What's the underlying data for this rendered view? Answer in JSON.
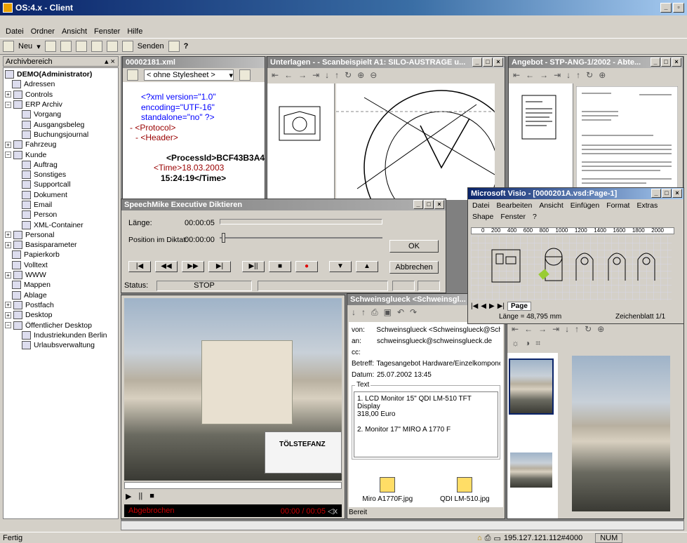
{
  "app": {
    "title": "OS:4.x - Client",
    "status": "Fertig",
    "ip": "195.127.121.112#4000",
    "num": "NUM"
  },
  "menu": [
    "Datei",
    "Ordner",
    "Ansicht",
    "Fenster",
    "Hilfe"
  ],
  "toolbar": {
    "new_label": "Neu",
    "send_label": "Senden"
  },
  "sidebar": {
    "title": "Archivbereich",
    "items": [
      {
        "label": "DEMO(Administrator)",
        "indent": 0,
        "bold": true
      },
      {
        "label": "Adressen",
        "indent": 1
      },
      {
        "label": "Controls",
        "indent": 0,
        "pm": "+"
      },
      {
        "label": "ERP Archiv",
        "indent": 0,
        "pm": "−"
      },
      {
        "label": "Vorgang",
        "indent": 2
      },
      {
        "label": "Ausgangsbeleg",
        "indent": 2
      },
      {
        "label": "Buchungsjournal",
        "indent": 2
      },
      {
        "label": "Fahrzeug",
        "indent": 0,
        "pm": "+"
      },
      {
        "label": "Kunde",
        "indent": 0,
        "pm": "−"
      },
      {
        "label": "Auftrag",
        "indent": 2
      },
      {
        "label": "Sonstiges",
        "indent": 2
      },
      {
        "label": "Supportcall",
        "indent": 2
      },
      {
        "label": "Dokument",
        "indent": 2
      },
      {
        "label": "Email",
        "indent": 2
      },
      {
        "label": "Person",
        "indent": 2
      },
      {
        "label": "XML-Container",
        "indent": 2
      },
      {
        "label": "Personal",
        "indent": 0,
        "pm": "+"
      },
      {
        "label": "Basisparameter",
        "indent": 0,
        "pm": "+"
      },
      {
        "label": "Papierkorb",
        "indent": 1
      },
      {
        "label": "Volltext",
        "indent": 1
      },
      {
        "label": "WWW",
        "indent": 0,
        "pm": "+"
      },
      {
        "label": "Mappen",
        "indent": 1
      },
      {
        "label": "Ablage",
        "indent": 1
      },
      {
        "label": "Postfach",
        "indent": 0,
        "pm": "+"
      },
      {
        "label": "Desktop",
        "indent": 0,
        "pm": "+"
      },
      {
        "label": "Öffentlicher Desktop",
        "indent": 0,
        "pm": "−"
      },
      {
        "label": "Industriekunden Berlin",
        "indent": 2
      },
      {
        "label": "Urlaubsverwaltung",
        "indent": 2
      }
    ]
  },
  "xml_window": {
    "title": "00002181.xml",
    "stylesheet": "< ohne Stylesheet >",
    "lines": [
      "<?xml version=\"1.0\"",
      "encoding=\"UTF-16\"",
      "standalone=\"no\" ?>",
      "- <Protocol>",
      "- <Header>",
      "<ProcessId>BCF43B3A4",
      "<Time>18.03.2003",
      "15:24:19</Time>"
    ]
  },
  "scan_window": {
    "title": "Unterlagen - - Scanbeispielt A1: SILO-AUSTRAGE u..."
  },
  "angebot_window": {
    "title": "Angebot - STP-ANG-1/2002 - Abte..."
  },
  "visio": {
    "title": "Microsoft Visio - [0000201A.vsd:Page-1]",
    "menu1": [
      "Datei",
      "Bearbeiten",
      "Ansicht",
      "Einfügen",
      "Format",
      "Extras"
    ],
    "menu2": [
      "Shape",
      "Fenster",
      "?"
    ],
    "ruler": [
      "0",
      "200",
      "400",
      "600",
      "800",
      "1000",
      "1200",
      "1400",
      "1600",
      "1800",
      "2000"
    ],
    "page_tab": "Page",
    "length": "Länge = 48,795 mm",
    "sheet": "Zeichenblatt 1/1"
  },
  "dictation": {
    "title": "SpeechMike Executive Diktieren",
    "length_label": "Länge:",
    "length_value": "00:00:05",
    "pos_label": "Position im Diktat:",
    "pos_value": "00:00:00",
    "ok": "OK",
    "cancel": "Abbrechen",
    "status_label": "Status:",
    "status_value": "STOP"
  },
  "video": {
    "sign": "TÖLSTEFANZ",
    "aborted": "Abgebrochen",
    "time": "00:00 / 00:05"
  },
  "email": {
    "title": "Schweinsglueck <Schweinsgl...",
    "von_label": "von:",
    "von": "Schweinsglueck <Schweinsglueck@Sch",
    "an_label": "an:",
    "an": "schweinsglueck@schweinsglueck.de",
    "cc_label": "cc:",
    "betreff_label": "Betreff:",
    "betreff": "Tagesangebot Hardware/Einzelkompone",
    "datum_label": "Datum:",
    "datum": "25.07.2002 13:45",
    "text_label": "Text",
    "text_lines": [
      "1. LCD Monitor 15\" QDI LM-510 TFT",
      "Display",
      "318,00 Euro",
      "",
      "2. Monitor 17\" MIRO A 1770 F"
    ],
    "attachments": [
      "Miro A1770F.jpg",
      "QDI LM-510.jpg"
    ],
    "ready": "Bereit"
  }
}
